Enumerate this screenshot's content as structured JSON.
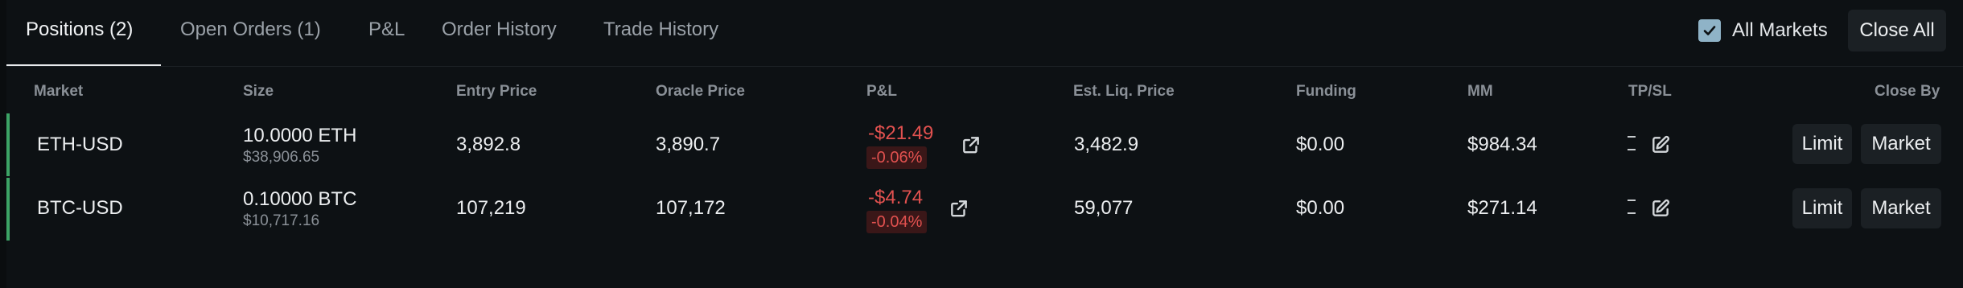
{
  "tabs": [
    {
      "label": "Positions (2)",
      "active": true
    },
    {
      "label": "Open Orders (1)",
      "active": false
    },
    {
      "label": "P&L",
      "active": false
    },
    {
      "label": "Order History",
      "active": false
    },
    {
      "label": "Trade History",
      "active": false
    }
  ],
  "controls": {
    "all_markets_label": "All Markets",
    "all_markets_checked": true,
    "close_all_label": "Close All"
  },
  "columns": [
    "Market",
    "Size",
    "Entry Price",
    "Oracle Price",
    "P&L",
    "Est. Liq. Price",
    "Funding",
    "MM",
    "TP/SL",
    "Close By"
  ],
  "positions": [
    {
      "market": "ETH-USD",
      "size": "10.0000 ETH",
      "size_usd": "$38,906.65",
      "entry_price": "3,892.8",
      "oracle_price": "3,890.7",
      "pnl": "-$21.49",
      "pnl_pct": "-0.06%",
      "est_liq_price": "3,482.9",
      "funding": "$0.00",
      "mm": "$984.34",
      "tpsl": "–",
      "close_limit": "Limit",
      "close_market": "Market"
    },
    {
      "market": "BTC-USD",
      "size": "0.10000 BTC",
      "size_usd": "$10,717.16",
      "entry_price": "107,219",
      "oracle_price": "107,172",
      "pnl": "-$4.74",
      "pnl_pct": "-0.04%",
      "est_liq_price": "59,077",
      "funding": "$0.00",
      "mm": "$271.14",
      "tpsl": "–",
      "close_limit": "Limit",
      "close_market": "Market"
    }
  ],
  "colors": {
    "background": "#0d1114",
    "negative": "#e1514f",
    "position_bar": "#3ca466",
    "checkbox": "#8fb3c7"
  },
  "icons": {
    "external_link": "external-link-icon",
    "edit": "edit-icon",
    "check": "check-icon"
  }
}
